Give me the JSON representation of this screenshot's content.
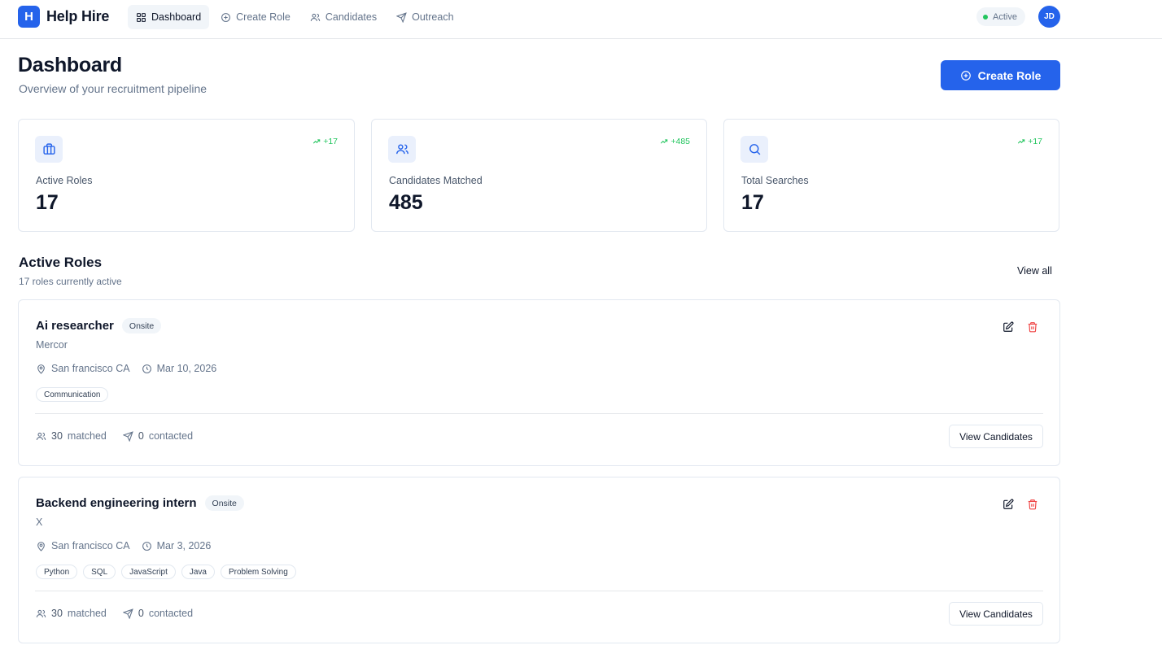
{
  "brand": {
    "logo_letter": "H",
    "name": "Help Hire"
  },
  "nav": [
    {
      "label": "Dashboard",
      "icon": "grid-icon",
      "active": true
    },
    {
      "label": "Create Role",
      "icon": "plus-circle-icon",
      "active": false
    },
    {
      "label": "Candidates",
      "icon": "users-icon",
      "active": false
    },
    {
      "label": "Outreach",
      "icon": "send-icon",
      "active": false
    }
  ],
  "status": {
    "label": "Active",
    "color": "#22c55e"
  },
  "user": {
    "initials": "JD"
  },
  "header": {
    "title": "Dashboard",
    "subtitle": "Overview of your recruitment pipeline",
    "create_button": "Create Role"
  },
  "stats": [
    {
      "label": "Active Roles",
      "value": "17",
      "trend": "+17",
      "icon": "briefcase-icon"
    },
    {
      "label": "Candidates Matched",
      "value": "485",
      "trend": "+485",
      "icon": "users-icon"
    },
    {
      "label": "Total Searches",
      "value": "17",
      "trend": "+17",
      "icon": "search-icon"
    }
  ],
  "section": {
    "title": "Active Roles",
    "subtitle": "17 roles currently active",
    "view_all": "View all"
  },
  "roles": [
    {
      "title": "Ai researcher",
      "badge": "Onsite",
      "company": "Mercor",
      "location": "San francisco CA",
      "date": "Mar 10, 2026",
      "skills": [
        "Communication"
      ],
      "matched_count": "30",
      "matched_label": "matched",
      "contacted_count": "0",
      "contacted_label": "contacted",
      "button": "View Candidates"
    },
    {
      "title": "Backend engineering intern",
      "badge": "Onsite",
      "company": "X",
      "location": "San francisco CA",
      "date": "Mar 3, 2026",
      "skills": [
        "Python",
        "SQL",
        "JavaScript",
        "Java",
        "Problem Solving"
      ],
      "matched_count": "30",
      "matched_label": "matched",
      "contacted_count": "0",
      "contacted_label": "contacted",
      "button": "View Candidates"
    }
  ],
  "colors": {
    "primary": "#2563eb",
    "trend": "#22c55e",
    "danger": "#ef4444"
  }
}
